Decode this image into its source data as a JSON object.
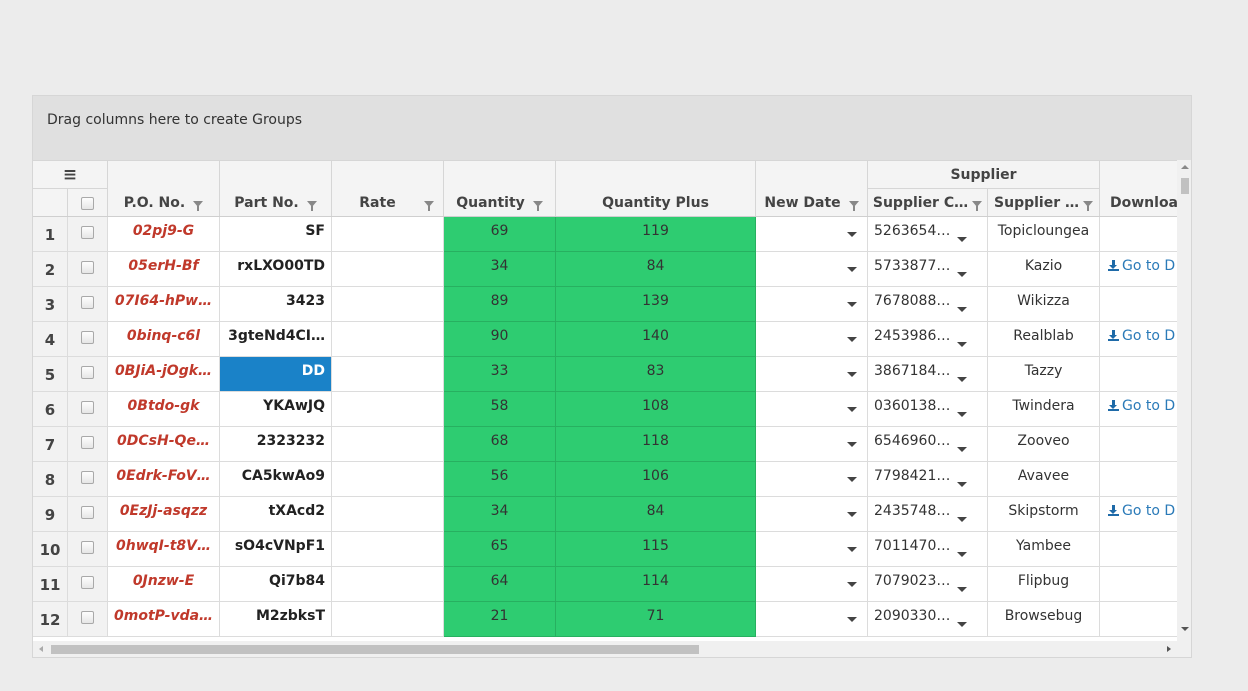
{
  "group_panel": {
    "text": "Drag columns here to create Groups"
  },
  "header": {
    "menu_icon": "≡",
    "supplier_group": "Supplier",
    "columns": {
      "po": "P.O. No.",
      "part": "Part No.",
      "rate": "Rate",
      "quantity": "Quantity",
      "quantity_plus": "Quantity Plus",
      "new_date": "New Date",
      "supplier_code": "Supplier C…",
      "supplier_name": "Supplier …",
      "download": "Downloa"
    }
  },
  "colors": {
    "quantity_bg": "#2ecc71",
    "po_text": "#c0392b",
    "selected_cell": "#1a82c8",
    "link": "#2a7ab8"
  },
  "rows": [
    {
      "num": "1",
      "po": "02pj9-G",
      "part": "SF",
      "rate": "",
      "qty": "69",
      "qplus": "119",
      "scode": "5263654…",
      "sname": "Topicloungea",
      "dl": ""
    },
    {
      "num": "2",
      "po": "05erH-Bf",
      "part": "rxLXO00TD",
      "rate": "",
      "qty": "34",
      "qplus": "84",
      "scode": "5733877…",
      "sname": "Kazio",
      "dl": "Go to D"
    },
    {
      "num": "3",
      "po": "07I64-hPw…",
      "part": "3423",
      "rate": "",
      "qty": "89",
      "qplus": "139",
      "scode": "7678088…",
      "sname": "Wikizza",
      "dl": ""
    },
    {
      "num": "4",
      "po": "0binq-c6l",
      "part": "3gteNd4CI…",
      "rate": "",
      "qty": "90",
      "qplus": "140",
      "scode": "2453986…",
      "sname": "Realblab",
      "dl": "Go to D"
    },
    {
      "num": "5",
      "po": "0BJiA-jOgk…",
      "part": "DD",
      "rate": "",
      "qty": "33",
      "qplus": "83",
      "scode": "3867184…",
      "sname": "Tazzy",
      "dl": ""
    },
    {
      "num": "6",
      "po": "0Btdo-gk",
      "part": "YKAwJQ",
      "rate": "",
      "qty": "58",
      "qplus": "108",
      "scode": "0360138…",
      "sname": "Twindera",
      "dl": "Go to D"
    },
    {
      "num": "7",
      "po": "0DCsH-Qe…",
      "part": "2323232",
      "rate": "",
      "qty": "68",
      "qplus": "118",
      "scode": "6546960…",
      "sname": "Zooveo",
      "dl": ""
    },
    {
      "num": "8",
      "po": "0Edrk-FoV…",
      "part": "CA5kwAo9",
      "rate": "",
      "qty": "56",
      "qplus": "106",
      "scode": "7798421…",
      "sname": "Avavee",
      "dl": ""
    },
    {
      "num": "9",
      "po": "0EzJj-asqzz",
      "part": "tXAcd2",
      "rate": "",
      "qty": "34",
      "qplus": "84",
      "scode": "2435748…",
      "sname": "Skipstorm",
      "dl": "Go to D"
    },
    {
      "num": "10",
      "po": "0hwqI-t8V…",
      "part": "sO4cVNpF1",
      "rate": "",
      "qty": "65",
      "qplus": "115",
      "scode": "7011470…",
      "sname": "Yambee",
      "dl": ""
    },
    {
      "num": "11",
      "po": "0Jnzw-E",
      "part": "Qi7b84",
      "rate": "",
      "qty": "64",
      "qplus": "114",
      "scode": "7079023…",
      "sname": "Flipbug",
      "dl": ""
    },
    {
      "num": "12",
      "po": "0motP-vda…",
      "part": "M2zbksT",
      "rate": "",
      "qty": "21",
      "qplus": "71",
      "scode": "2090330…",
      "sname": "Browsebug",
      "dl": ""
    }
  ],
  "selected_cell": {
    "row": "5",
    "column": "part"
  }
}
